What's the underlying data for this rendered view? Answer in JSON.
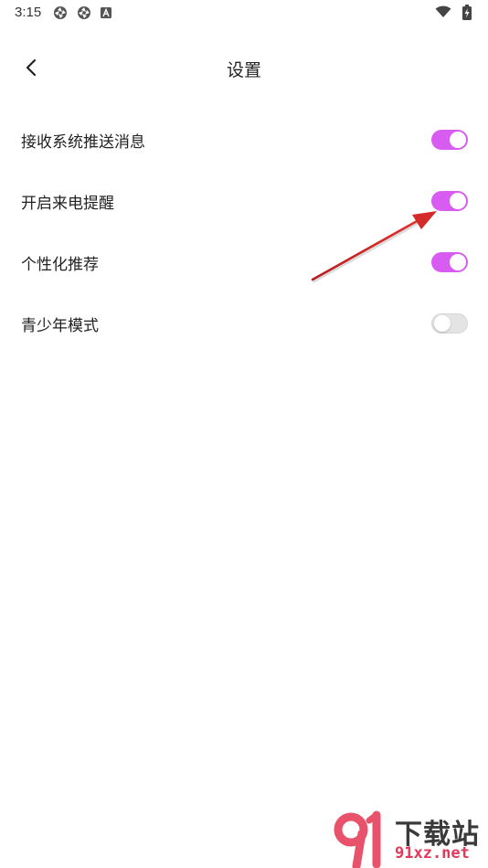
{
  "status_bar": {
    "time": "3:15",
    "left_icons": [
      "aperture-icon",
      "aperture-icon",
      "app-a-icon"
    ],
    "right_icons": [
      "wifi-icon",
      "battery-charging-icon"
    ]
  },
  "header": {
    "back_icon": "chevron-left-icon",
    "title": "设置"
  },
  "settings": {
    "items": [
      {
        "label": "接收系统推送消息",
        "enabled": true
      },
      {
        "label": "开启来电提醒",
        "enabled": true
      },
      {
        "label": "个性化推荐",
        "enabled": true
      },
      {
        "label": "青少年模式",
        "enabled": false
      }
    ]
  },
  "annotation": {
    "type": "red-arrow",
    "target": "开启来电提醒"
  },
  "watermark": {
    "brand": "下载站",
    "url": "91xz.net"
  },
  "colors": {
    "toggle_on": "#d95cf2",
    "toggle_off": "#e4e4e4",
    "arrow": "#d42a2a",
    "watermark_url": "#e0395a",
    "watermark_logo": "#e8526a"
  }
}
